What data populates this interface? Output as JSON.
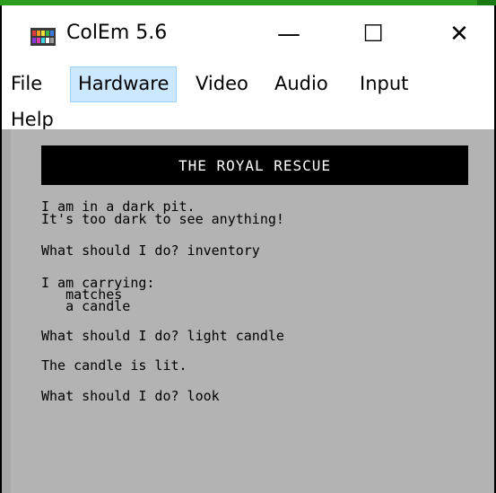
{
  "window": {
    "title": "ColEm 5.6",
    "controls": {
      "minimize": "—",
      "maximize": "☐",
      "close": "✕"
    },
    "icon": "colem-app-icon"
  },
  "menu": {
    "items": [
      {
        "label": "File"
      },
      {
        "label": "Hardware"
      },
      {
        "label": "Video"
      },
      {
        "label": "Audio"
      },
      {
        "label": "Input"
      },
      {
        "label": "Help"
      }
    ],
    "active": "Hardware"
  },
  "screen": {
    "banner": "THE ROYAL RESCUE",
    "lines": [
      "I am in a dark pit.",
      "It's too dark to see anything!",
      "What should I do? inventory",
      "I am carrying:",
      "   matches",
      "   a candle",
      "What should I do? light candle",
      "The candle is lit.",
      "What should I do? look"
    ]
  },
  "colors": {
    "screen_bg": "#b3b3b3",
    "banner_bg": "#000000",
    "banner_fg": "#ffffff",
    "menu_active_bg": "#cce8ff",
    "top_strip": "#2e9c1f"
  }
}
